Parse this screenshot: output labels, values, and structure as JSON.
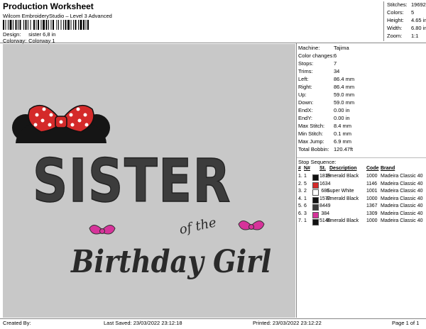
{
  "header": {
    "title": "Production Worksheet",
    "software": "Wilcom EmbroideryStudio – Level 3 Advanced",
    "design_label": "Design:",
    "design_value": "sister 6,8 in",
    "colorway_label": "Colorway:",
    "colorway_value": "Colorway 1"
  },
  "summary": [
    {
      "label": "Stitches:",
      "value": "19692"
    },
    {
      "label": "Colors:",
      "value": "5"
    },
    {
      "label": "Height:",
      "value": "4.65 in"
    },
    {
      "label": "Width:",
      "value": "6.80 in"
    },
    {
      "label": "Zoom:",
      "value": "1:1"
    }
  ],
  "machine_info": [
    {
      "label": "Machine:",
      "value": "Tajima"
    },
    {
      "label": "Color changes:",
      "value": "6"
    },
    {
      "label": "Stops:",
      "value": "7"
    },
    {
      "label": "Trims:",
      "value": "34"
    },
    {
      "label": "Left:",
      "value": "86.4 mm"
    },
    {
      "label": "Right:",
      "value": "86.4 mm"
    },
    {
      "label": "Up:",
      "value": "59.0 mm"
    },
    {
      "label": "Down:",
      "value": "59.0 mm"
    },
    {
      "label": "EndX:",
      "value": "0.00 in"
    },
    {
      "label": "EndY:",
      "value": "0.00 in"
    },
    {
      "label": "Max Stitch:",
      "value": "8.4 mm"
    },
    {
      "label": "Min Stitch:",
      "value": "0.1 mm"
    },
    {
      "label": "Max Jump:",
      "value": "6.9 mm"
    },
    {
      "label": "Total Bobbin:",
      "value": "120.47ft"
    }
  ],
  "stop_sequence": {
    "heading": "Stop Sequence:",
    "columns": [
      "#",
      "N#",
      "St.",
      "Description",
      "Code",
      "Brand"
    ],
    "rows": [
      {
        "num": "1.",
        "n": "1",
        "st": "1819",
        "desc": "Emerald Black",
        "code": "1000",
        "brand": "Madeira Classic 40",
        "color": "#111111"
      },
      {
        "num": "2.",
        "n": "5",
        "st": "1634",
        "desc": "",
        "code": "1146",
        "brand": "Madeira Classic 40",
        "color": "#d42a2a"
      },
      {
        "num": "3.",
        "n": "2",
        "st": "686",
        "desc": "Super White",
        "code": "1001",
        "brand": "Madeira Classic 40",
        "color": "#ffffff"
      },
      {
        "num": "4.",
        "n": "1",
        "st": "1572",
        "desc": "Emerald Black",
        "code": "1000",
        "brand": "Madeira Classic 40",
        "color": "#111111"
      },
      {
        "num": "5.",
        "n": "6",
        "st": "8449",
        "desc": "",
        "code": "1367",
        "brand": "Madeira Classic 40",
        "color": "#3a3a3a"
      },
      {
        "num": "6.",
        "n": "3",
        "st": "384",
        "desc": "",
        "code": "1309",
        "brand": "Madeira Classic 40",
        "color": "#d6339a"
      },
      {
        "num": "7.",
        "n": "1",
        "st": "5146",
        "desc": "Emerald Black",
        "code": "1000",
        "brand": "Madeira Classic 40",
        "color": "#111111"
      }
    ]
  },
  "design_preview": {
    "word_main": "SISTER",
    "word_small": "of the",
    "word_script": "Birthday Girl",
    "colors": {
      "thread_dark": "#3c3c3c",
      "bow_red": "#d42a2a",
      "bow_pink": "#d6339a",
      "ear_black": "#151515",
      "background": "#c8c8c8"
    }
  },
  "footer": {
    "created_by": "Created By:",
    "last_saved": "Last Saved: 23/03/2022 23:12:18",
    "printed": "Printed: 23/03/2022 23:12:22",
    "page": "Page 1 of 1"
  }
}
